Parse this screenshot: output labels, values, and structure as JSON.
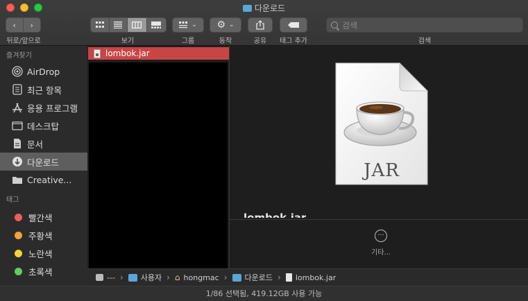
{
  "window": {
    "title": "다운로드"
  },
  "toolbar": {
    "back_forward_label": "뒤로/앞으로",
    "view_label": "보기",
    "group_label": "그룹",
    "action_label": "동작",
    "share_label": "공유",
    "tag_label": "태그 추가",
    "search_label": "검색",
    "search_placeholder": "검색"
  },
  "sidebar": {
    "favorites_header": "즐겨찾기",
    "favorites": [
      {
        "label": "AirDrop",
        "icon": "airdrop-icon"
      },
      {
        "label": "최근 항목",
        "icon": "recents-icon"
      },
      {
        "label": "응용 프로그램",
        "icon": "applications-icon"
      },
      {
        "label": "데스크탑",
        "icon": "desktop-icon"
      },
      {
        "label": "문서",
        "icon": "documents-icon"
      },
      {
        "label": "다운로드",
        "icon": "downloads-icon",
        "selected": true
      },
      {
        "label": "Creative...",
        "icon": "folder-icon"
      }
    ],
    "tags_header": "태그",
    "tags": [
      {
        "label": "빨간색",
        "color": "#ec5f5d"
      },
      {
        "label": "주황색",
        "color": "#f2a33a"
      },
      {
        "label": "노란색",
        "color": "#f4d23a"
      },
      {
        "label": "초록색",
        "color": "#5fcf5a"
      }
    ]
  },
  "column": {
    "selected_file": "lombok.jar"
  },
  "preview": {
    "file_name": "lombok.jar",
    "file_type_text": "JAR",
    "more_label": "기타..."
  },
  "pathbar": {
    "items": [
      "---",
      "사용자",
      "hongmac",
      "다운로드",
      "lombok.jar"
    ],
    "separator": "›"
  },
  "status": {
    "text": "1/86 선택됨, 419.12GB 사용 가능"
  }
}
